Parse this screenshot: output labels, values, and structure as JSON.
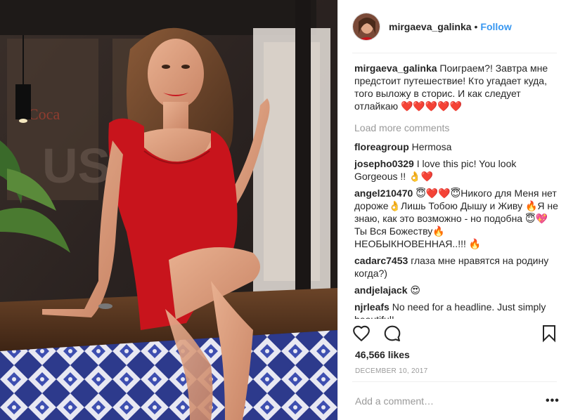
{
  "post": {
    "username": "mirgaeva_galinka",
    "separator": "•",
    "follow_label": "Follow",
    "caption": "Поиграем?! Завтра мне предстоит путешествие! Кто угадает куда, того выложу в сторис. И как следует отлайкаю ❤️❤️❤️❤️❤️",
    "load_more_label": "Load more comments",
    "likes": "46,566 likes",
    "date": "DECEMBER 10, 2017",
    "add_comment_placeholder": "Add a comment…",
    "more_label": "•••"
  },
  "comments": [
    {
      "user": "floreagroup",
      "text": "Hermosa"
    },
    {
      "user": "josepho0329",
      "text": "I love this pic! You look Gorgeous !! 👌❤️"
    },
    {
      "user": "angel210470",
      "text": "😇❤️❤️😇Никого для Меня нет дороже👌Лишь Тобою Дышу и Живу 🔥Я не знаю, как это возможно - но подобна 😇💖Ты Вся Божеству🔥 НЕОБЫКНОВЕННАЯ..!!! 🔥"
    },
    {
      "user": "cadarc7453",
      "text": "глаза мне нравятся на родину когда?)"
    },
    {
      "user": "andjelajack",
      "text": "😍"
    },
    {
      "user": "njrleafs",
      "text": "No need for a headline. Just simply beautiful!"
    }
  ],
  "icons": {
    "like": "heart-icon",
    "comment": "comment-bubble-icon",
    "save": "bookmark-icon"
  },
  "colors": {
    "follow": "#3897f0",
    "muted": "#999999",
    "text": "#262626",
    "dress": "#c8141c"
  }
}
